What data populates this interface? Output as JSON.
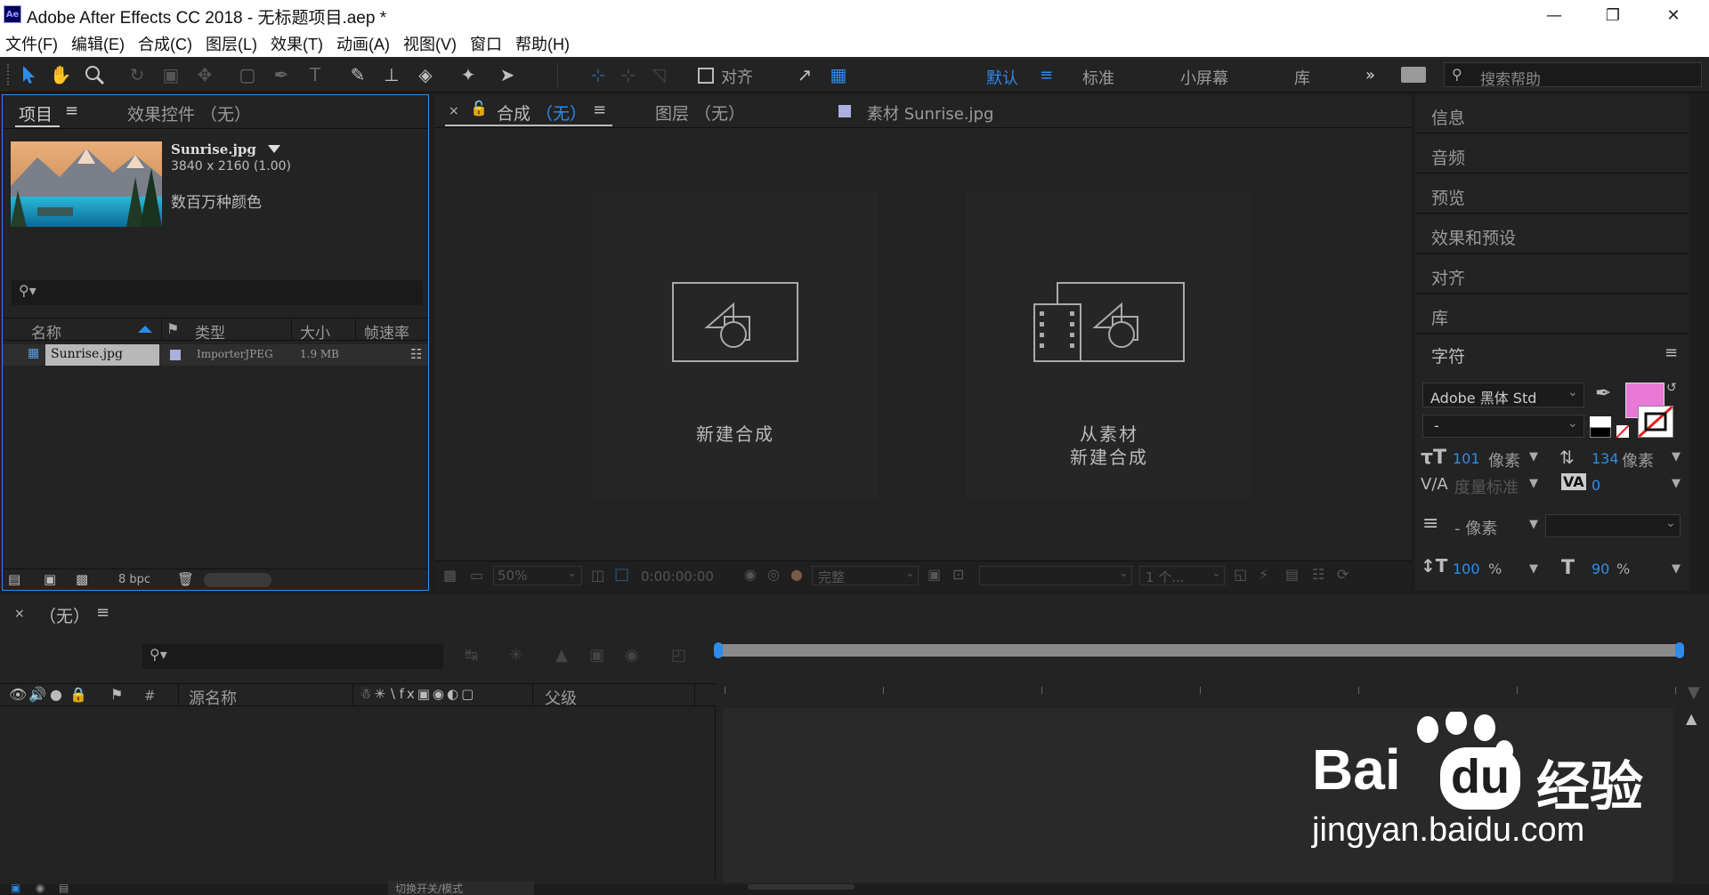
{
  "window": {
    "app_icon": "Ae",
    "title": "Adobe After Effects CC 2018 - 无标题项目.aep *",
    "controls": [
      "minimize-icon",
      "restore-icon",
      "close-icon"
    ]
  },
  "menu": [
    "文件(F)",
    "编辑(E)",
    "合成(C)",
    "图层(L)",
    "效果(T)",
    "动画(A)",
    "视图(V)",
    "窗口",
    "帮助(H)"
  ],
  "toolbar": {
    "align_label": "对齐",
    "workspaces": [
      "默认",
      "标准",
      "小屏幕",
      "库"
    ],
    "active_workspace": "默认",
    "search_placeholder": "搜索帮助",
    "expand_glyph": "»"
  },
  "project_panel": {
    "tab_project": "项目",
    "tab_effects": "效果控件 （无）",
    "file_name": "Sunrise.jpg",
    "file_dims": "3840 x 2160 (1.00)",
    "file_colors": "数百万种颜色",
    "columns": [
      "名称",
      "类型",
      "大小",
      "帧速率"
    ],
    "rows": [
      {
        "name": "Sunrise.jpg",
        "type": "ImporterJPEG",
        "size": "1.9 MB"
      }
    ],
    "bpc": "8 bpc"
  },
  "viewer": {
    "tab_comp": "合成",
    "tab_comp_state": "（无）",
    "tab_layer": "图层 （无）",
    "tab_footage": "素材 Sunrise.jpg",
    "new_comp": "新建合成",
    "from_footage_line1": "从素材",
    "from_footage_line2": "新建合成",
    "zoom": "50%",
    "timecode": "0:00:00:00",
    "quality": "完整",
    "views": "1 个..."
  },
  "right_panels": {
    "items": [
      "信息",
      "音频",
      "预览",
      "效果和预设",
      "对齐",
      "库",
      "字符"
    ],
    "font_family": "Adobe 黑体 Std",
    "font_style": "-",
    "font_size": "101",
    "font_size_unit": "像素",
    "leading": "134",
    "leading_unit": "像素",
    "kerning": "度量标准",
    "tracking": "0",
    "stroke_label": "- 像素",
    "vscale": "100",
    "hscale": "90",
    "pct": "%",
    "fill_color": "#e879d6"
  },
  "timeline": {
    "tab": "（无）",
    "col_number": "#",
    "col_source": "源名称",
    "col_parent": "父级",
    "bottom_label": "切换开关/模式"
  },
  "watermark": {
    "brand": "Bai",
    "brand2": "du",
    "cn": "经验",
    "url": "jingyan.baidu.com"
  }
}
